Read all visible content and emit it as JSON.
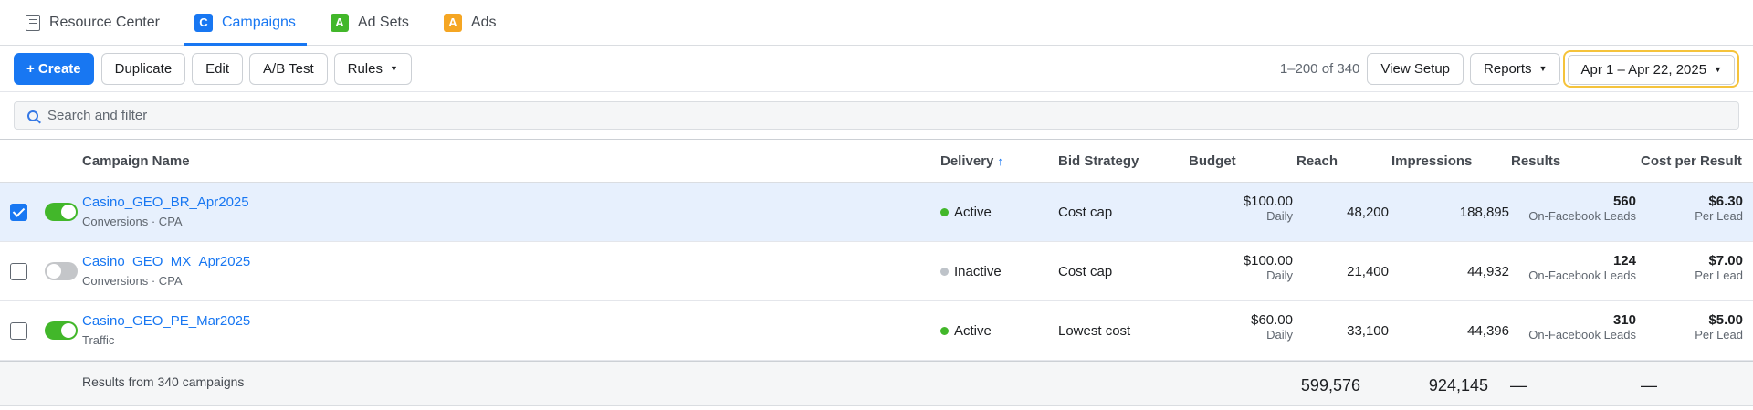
{
  "tabs": [
    {
      "label": "Resource Center",
      "icon": "document-icon",
      "active": false
    },
    {
      "label": "Campaigns",
      "badge": "C",
      "badge_color": "#1877f2",
      "active": true
    },
    {
      "label": "Ad Sets",
      "badge": "A",
      "badge_color": "#42b72a",
      "active": false
    },
    {
      "label": "Ads",
      "badge": "A",
      "badge_color": "#f5a623",
      "active": false
    }
  ],
  "toolbar": {
    "create_label": "+ Create",
    "duplicate_label": "Duplicate",
    "edit_label": "Edit",
    "ab_test_label": "A/B Test",
    "rules_label": "Rules",
    "range_text": "1–200 of 340",
    "view_setup_label": "View Setup",
    "reports_label": "Reports",
    "date_range_label": "Apr 1 – Apr 22, 2025"
  },
  "search": {
    "placeholder": "Search and filter"
  },
  "columns": {
    "name": "Campaign Name",
    "delivery": "Delivery",
    "bid_strategy": "Bid Strategy",
    "budget": "Budget",
    "reach": "Reach",
    "impressions": "Impressions",
    "results": "Results",
    "cost_per_result": "Cost per Result"
  },
  "rows": [
    {
      "selected": true,
      "enabled": true,
      "name": "Casino_GEO_BR_Apr2025",
      "objective": "Conversions · CPA",
      "delivery": "Active",
      "delivery_color": "#42b72a",
      "bid_strategy": "Cost cap",
      "budget": "$100.00",
      "budget_period": "Daily",
      "reach": "48,200",
      "impressions": "188,895",
      "results": "560",
      "results_type": "On-Facebook Leads",
      "cost": "$6.30",
      "cost_unit": "Per Lead"
    },
    {
      "selected": false,
      "enabled": false,
      "name": "Casino_GEO_MX_Apr2025",
      "objective": "Conversions · CPA",
      "delivery": "Inactive",
      "delivery_color": "#bec3c9",
      "bid_strategy": "Cost cap",
      "budget": "$100.00",
      "budget_period": "Daily",
      "reach": "21,400",
      "impressions": "44,932",
      "results": "124",
      "results_type": "On-Facebook Leads",
      "cost": "$7.00",
      "cost_unit": "Per Lead"
    },
    {
      "selected": false,
      "enabled": true,
      "name": "Casino_GEO_PE_Mar2025",
      "objective": "Traffic",
      "delivery": "Active",
      "delivery_color": "#42b72a",
      "bid_strategy": "Lowest cost",
      "budget": "$60.00",
      "budget_period": "Daily",
      "reach": "33,100",
      "impressions": "44,396",
      "results": "310",
      "results_type": "On-Facebook Leads",
      "cost": "$5.00",
      "cost_unit": "Per Lead"
    }
  ],
  "footer": {
    "label": "Results from 340 campaigns",
    "reach_total": "599,576",
    "impressions_total": "924,145",
    "results_total": "—",
    "cost_total": "—"
  }
}
